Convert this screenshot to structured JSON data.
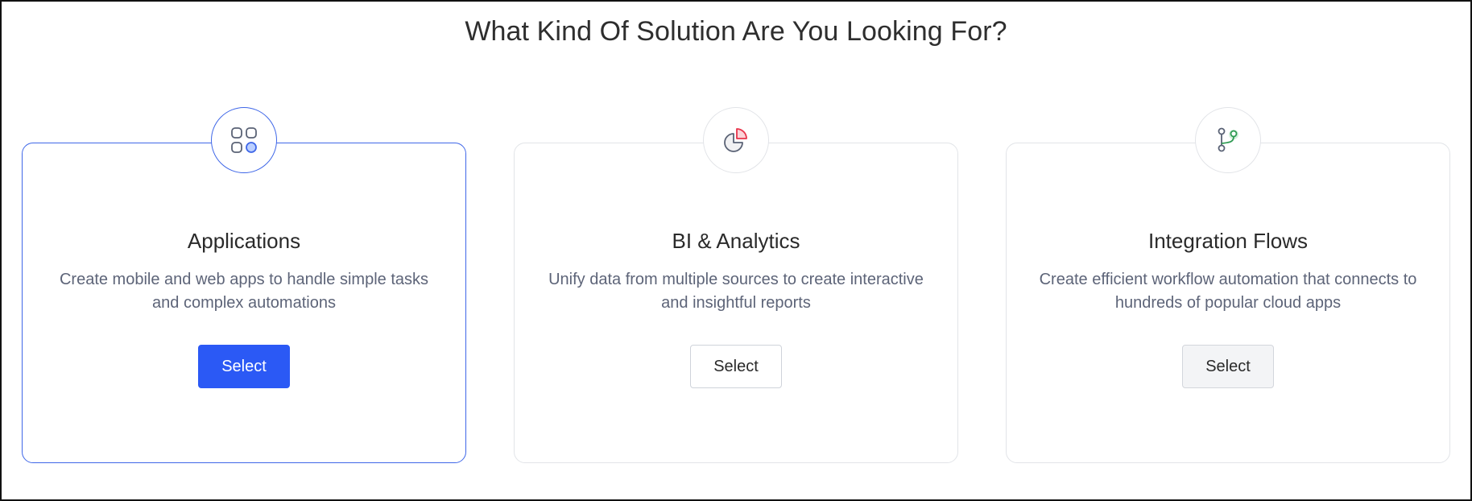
{
  "page": {
    "title": "What Kind Of Solution Are You Looking For?"
  },
  "cards": [
    {
      "title": "Applications",
      "description": "Create mobile and web apps to handle simple tasks and complex automations",
      "button_label": "Select",
      "icon": "apps-grid-icon",
      "selected": true
    },
    {
      "title": "BI & Analytics",
      "description": "Unify data from multiple sources to create interactive and insightful reports",
      "button_label": "Select",
      "icon": "pie-chart-icon",
      "selected": false
    },
    {
      "title": "Integration Flows",
      "description": "Create efficient workflow automation that connects to hundreds of popular cloud apps",
      "button_label": "Select",
      "icon": "git-branch-icon",
      "selected": false
    }
  ],
  "colors": {
    "accent": "#2b59f5",
    "active_border": "#3f67e8",
    "analytics_red": "#e8334a",
    "integration_green": "#2e9a52"
  }
}
